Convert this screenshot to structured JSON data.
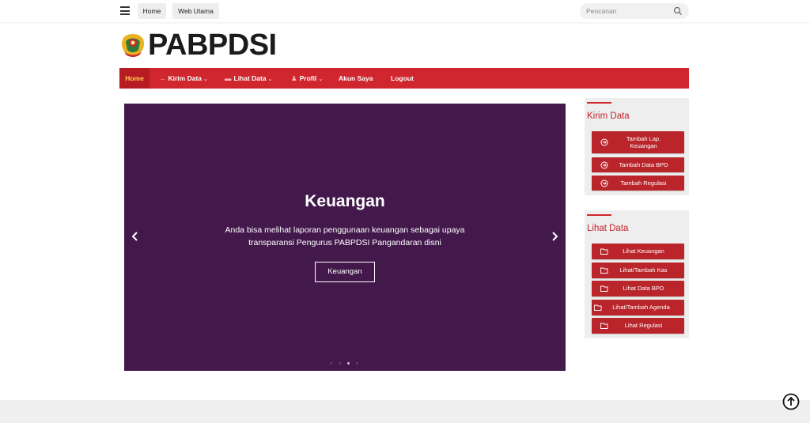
{
  "topbar": {
    "home_label": "Home",
    "web_label": "Web Utama",
    "search_placeholder": "Pencarian"
  },
  "logo": {
    "text": "PABPDSI"
  },
  "nav": {
    "items": [
      {
        "label": "Home",
        "icon": "",
        "caret": ""
      },
      {
        "label": "Kirim Data",
        "icon": "arrow-right-icon",
        "caret": "⌄"
      },
      {
        "label": "Lihat Data",
        "icon": "folder-icon",
        "caret": "⌄"
      },
      {
        "label": "Profil",
        "icon": "user-icon",
        "caret": "⌄"
      },
      {
        "label": "Akun Saya",
        "icon": "",
        "caret": ""
      },
      {
        "label": "Logout",
        "icon": "",
        "caret": ""
      }
    ],
    "colors": {
      "bar": "#d0262d",
      "active_bg": "#b81c23",
      "active_text": "#ffd34d"
    }
  },
  "carousel": {
    "title": "Keuangan",
    "description_line1": "Anda bisa melihat laporan penggunaan keuangan sebagai upaya",
    "description_line2": "transparansi Pengurus PABPDSI Pangandaran disni",
    "button_label": "Keuangan",
    "background": "#43194c",
    "slide_count": 4,
    "active_index": 2
  },
  "sidebar": {
    "kirim": {
      "title": "Kirim Data",
      "buttons": [
        {
          "label_line1": "Tambah Lap.",
          "label_line2": "Keuangan",
          "icon": "circle-arrow-right-icon"
        },
        {
          "label_line1": "Tambah Data BPD",
          "label_line2": "",
          "icon": "circle-arrow-right-icon"
        },
        {
          "label_line1": "Tambah Regulasi",
          "label_line2": "",
          "icon": "circle-arrow-right-icon"
        }
      ]
    },
    "lihat": {
      "title": "Lihat Data",
      "buttons": [
        {
          "label": "Lihat Keuangan",
          "icon": "folder-open-icon"
        },
        {
          "label": "Lihat/Tambah Kas",
          "icon": "folder-open-icon"
        },
        {
          "label": "Lihat Data BPD",
          "icon": "folder-open-icon"
        },
        {
          "label": "Lihat/Tambah Agenda",
          "icon": "folder-open-icon"
        },
        {
          "label": "Lihat Regulasi",
          "icon": "folder-open-icon"
        }
      ]
    },
    "accent": "#b9252b"
  }
}
